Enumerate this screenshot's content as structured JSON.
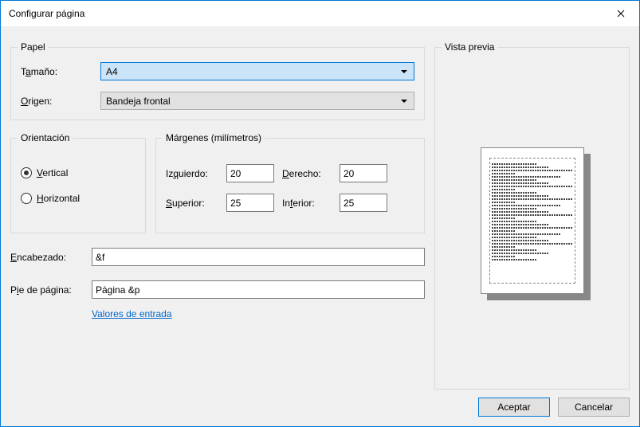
{
  "window": {
    "title": "Configurar página"
  },
  "paper": {
    "legend": "Papel",
    "size_label_pre": "T",
    "size_label_u": "a",
    "size_label_post": "maño:",
    "size_value": "A4",
    "source_label_pre": "",
    "source_label_u": "O",
    "source_label_post": "rigen:",
    "source_value": "Bandeja frontal"
  },
  "orientation": {
    "legend": "Orientación",
    "vertical_u": "V",
    "vertical_post": "ertical",
    "horizontal_u": "H",
    "horizontal_post": "orizontal",
    "selected": "vertical"
  },
  "margins": {
    "legend": "Márgenes (milímetros)",
    "left_pre": "Iz",
    "left_u": "q",
    "left_post": "uierdo:",
    "left_val": "20",
    "right_u": "D",
    "right_post": "erecho:",
    "right_val": "20",
    "top_u": "S",
    "top_post": "uperior:",
    "top_val": "25",
    "bottom_pre": "In",
    "bottom_u": "f",
    "bottom_post": "erior:",
    "bottom_val": "25"
  },
  "header": {
    "label_u": "E",
    "label_post": "ncabezado:",
    "value": "&f"
  },
  "footer": {
    "label_pre": "P",
    "label_u": "i",
    "label_post": "e de página:",
    "value": "Página &p"
  },
  "link": {
    "text": "Valores de entrada"
  },
  "preview": {
    "legend": "Vista previa"
  },
  "buttons": {
    "ok": "Aceptar",
    "cancel": "Cancelar"
  }
}
